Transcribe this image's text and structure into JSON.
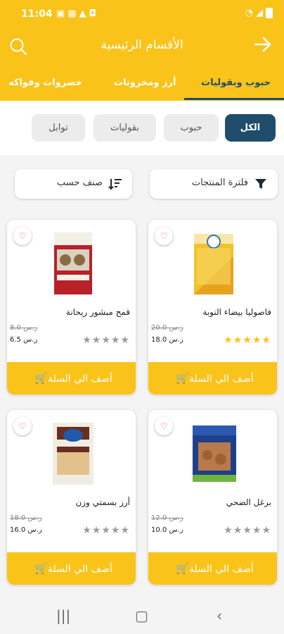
{
  "status": {
    "time": "11:04",
    "icons": [
      "sim-icon",
      "image-icon",
      "alert-icon",
      "notification-icon"
    ],
    "right_icons": [
      "wifi-icon",
      "signal-icon",
      "battery-icon"
    ]
  },
  "appbar": {
    "title": "الأقسام الرئيسية",
    "back_icon": "arrow-right-icon",
    "search_icon": "search-icon"
  },
  "categories": [
    {
      "label": "حبوب وبقوليات",
      "active": true
    },
    {
      "label": "أرز ومخرونات",
      "active": false
    },
    {
      "label": "خضروات وفواكه",
      "active": false
    }
  ],
  "chips": [
    {
      "label": "الكل",
      "active": true
    },
    {
      "label": "حبوب",
      "active": false
    },
    {
      "label": "بقوليات",
      "active": false
    },
    {
      "label": "توابل",
      "active": false
    }
  ],
  "tools": {
    "filter_label": "فلترة المنتجات",
    "sort_label": "صنف حسب"
  },
  "products": [
    {
      "name": "فاصوليا بيضاء النوبة",
      "old_price": "20.0 ر.س",
      "price": "18.0 ر.س",
      "rating": 5,
      "add_label": "أضف الي السلة"
    },
    {
      "name": "قمح مبشور ريحانة",
      "old_price": "8.0 ر.س",
      "price": "6.5 ر.س",
      "rating": 0,
      "add_label": "أضف الي السلة"
    },
    {
      "name": "برغل الضحي",
      "old_price": "12.0 ر.س",
      "price": "10.0 ر.س",
      "rating": 0,
      "add_label": "أضف الي السلة"
    },
    {
      "name": "أرز بسمتي وزن",
      "old_price": "18.0 ر.س",
      "price": "16.0 ر.س",
      "rating": 0,
      "add_label": "أضف الي السلة"
    }
  ],
  "colors": {
    "brand": "#f9c31a",
    "accent": "#1f4d6b",
    "favorite": "#e53b4f"
  },
  "navbar": {
    "icons": [
      "recent-apps-icon",
      "home-icon",
      "back-icon"
    ]
  }
}
